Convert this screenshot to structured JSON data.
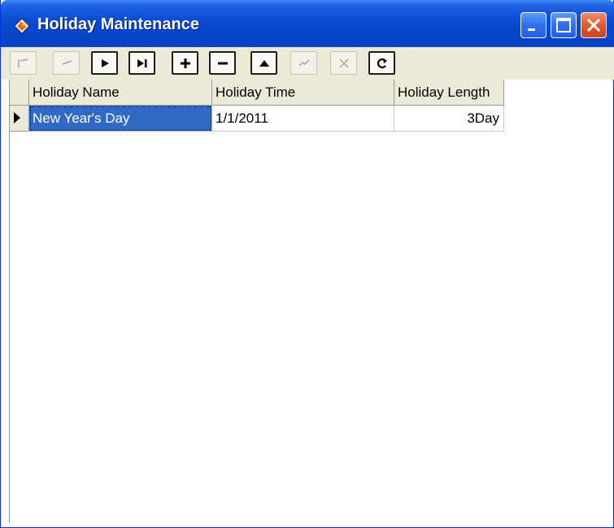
{
  "window": {
    "title": "Holiday Maintenance",
    "icon": "app-diamond-icon",
    "controls": [
      "minimize-icon",
      "maximize-icon",
      "close-icon"
    ]
  },
  "toolbar": {
    "buttons": [
      {
        "name": "first-record",
        "icon": "first-record-icon",
        "enabled": false
      },
      {
        "name": "prior-record",
        "icon": "prior-record-icon",
        "enabled": false
      },
      {
        "name": "next-record",
        "icon": "next-record-icon",
        "enabled": true
      },
      {
        "name": "last-record",
        "icon": "last-record-icon",
        "enabled": true
      },
      {
        "name": "insert-record",
        "icon": "plus-icon",
        "enabled": true
      },
      {
        "name": "delete-record",
        "icon": "minus-icon",
        "enabled": true
      },
      {
        "name": "edit-record",
        "icon": "triangle-up-icon",
        "enabled": true
      },
      {
        "name": "post-edit",
        "icon": "checkmark-icon",
        "enabled": false
      },
      {
        "name": "cancel-edit",
        "icon": "x-icon",
        "enabled": false
      },
      {
        "name": "refresh-data",
        "icon": "refresh-icon",
        "enabled": true
      }
    ]
  },
  "grid": {
    "columns": [
      "Holiday Name",
      "Holiday Time",
      "Holiday Length"
    ],
    "rows": [
      {
        "name": "New Year's Day",
        "time": "1/1/2011",
        "length": "3Day",
        "selected": true
      }
    ]
  },
  "colors": {
    "title_bar": "#0a4ad4",
    "selection": "#316ac5",
    "toolbar_bg": "#ece9d8"
  }
}
